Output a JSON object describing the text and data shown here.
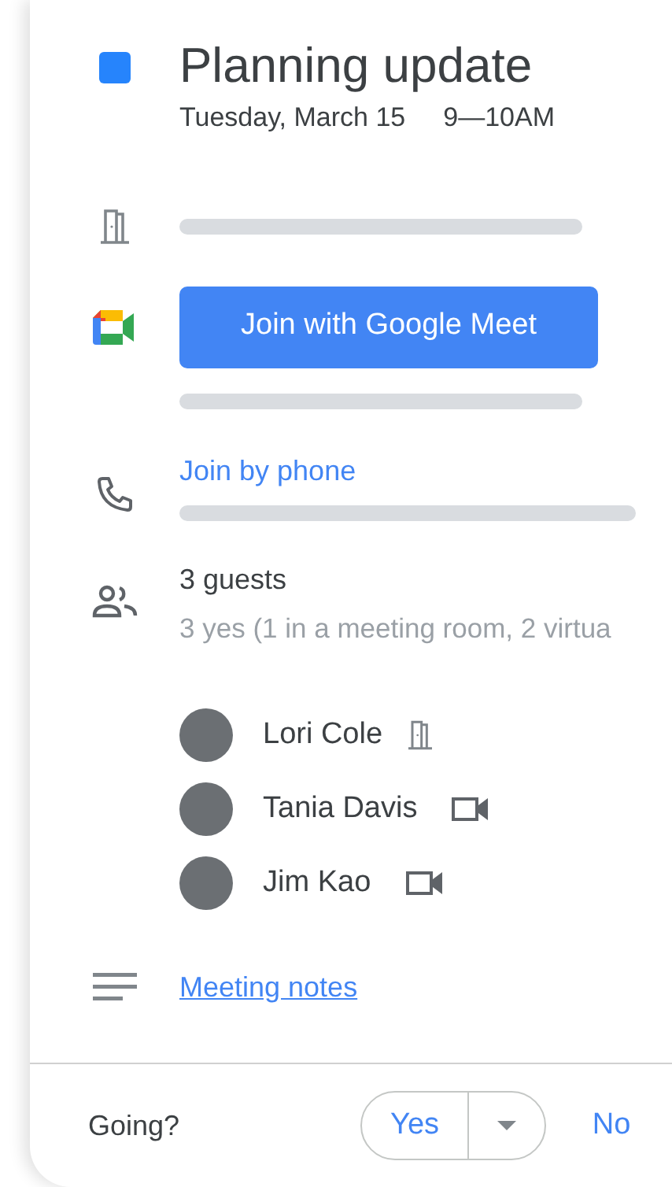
{
  "event": {
    "title": "Planning update",
    "date": "Tuesday, March 15",
    "time": "9—10AM",
    "color": "#2684fc"
  },
  "meet_button": "Join with Google Meet",
  "phone_link": "Join by phone",
  "guests": {
    "count": "3 guests",
    "summary": "3 yes (1 in a meeting room, 2 virtua",
    "people": [
      {
        "name": "Lori Cole",
        "kind": "room"
      },
      {
        "name": "Tania Davis",
        "kind": "video"
      },
      {
        "name": "Jim Kao",
        "kind": "video"
      }
    ]
  },
  "notes_link": "Meeting notes",
  "footer": {
    "question": "Going?",
    "yes": "Yes",
    "no": "No"
  }
}
